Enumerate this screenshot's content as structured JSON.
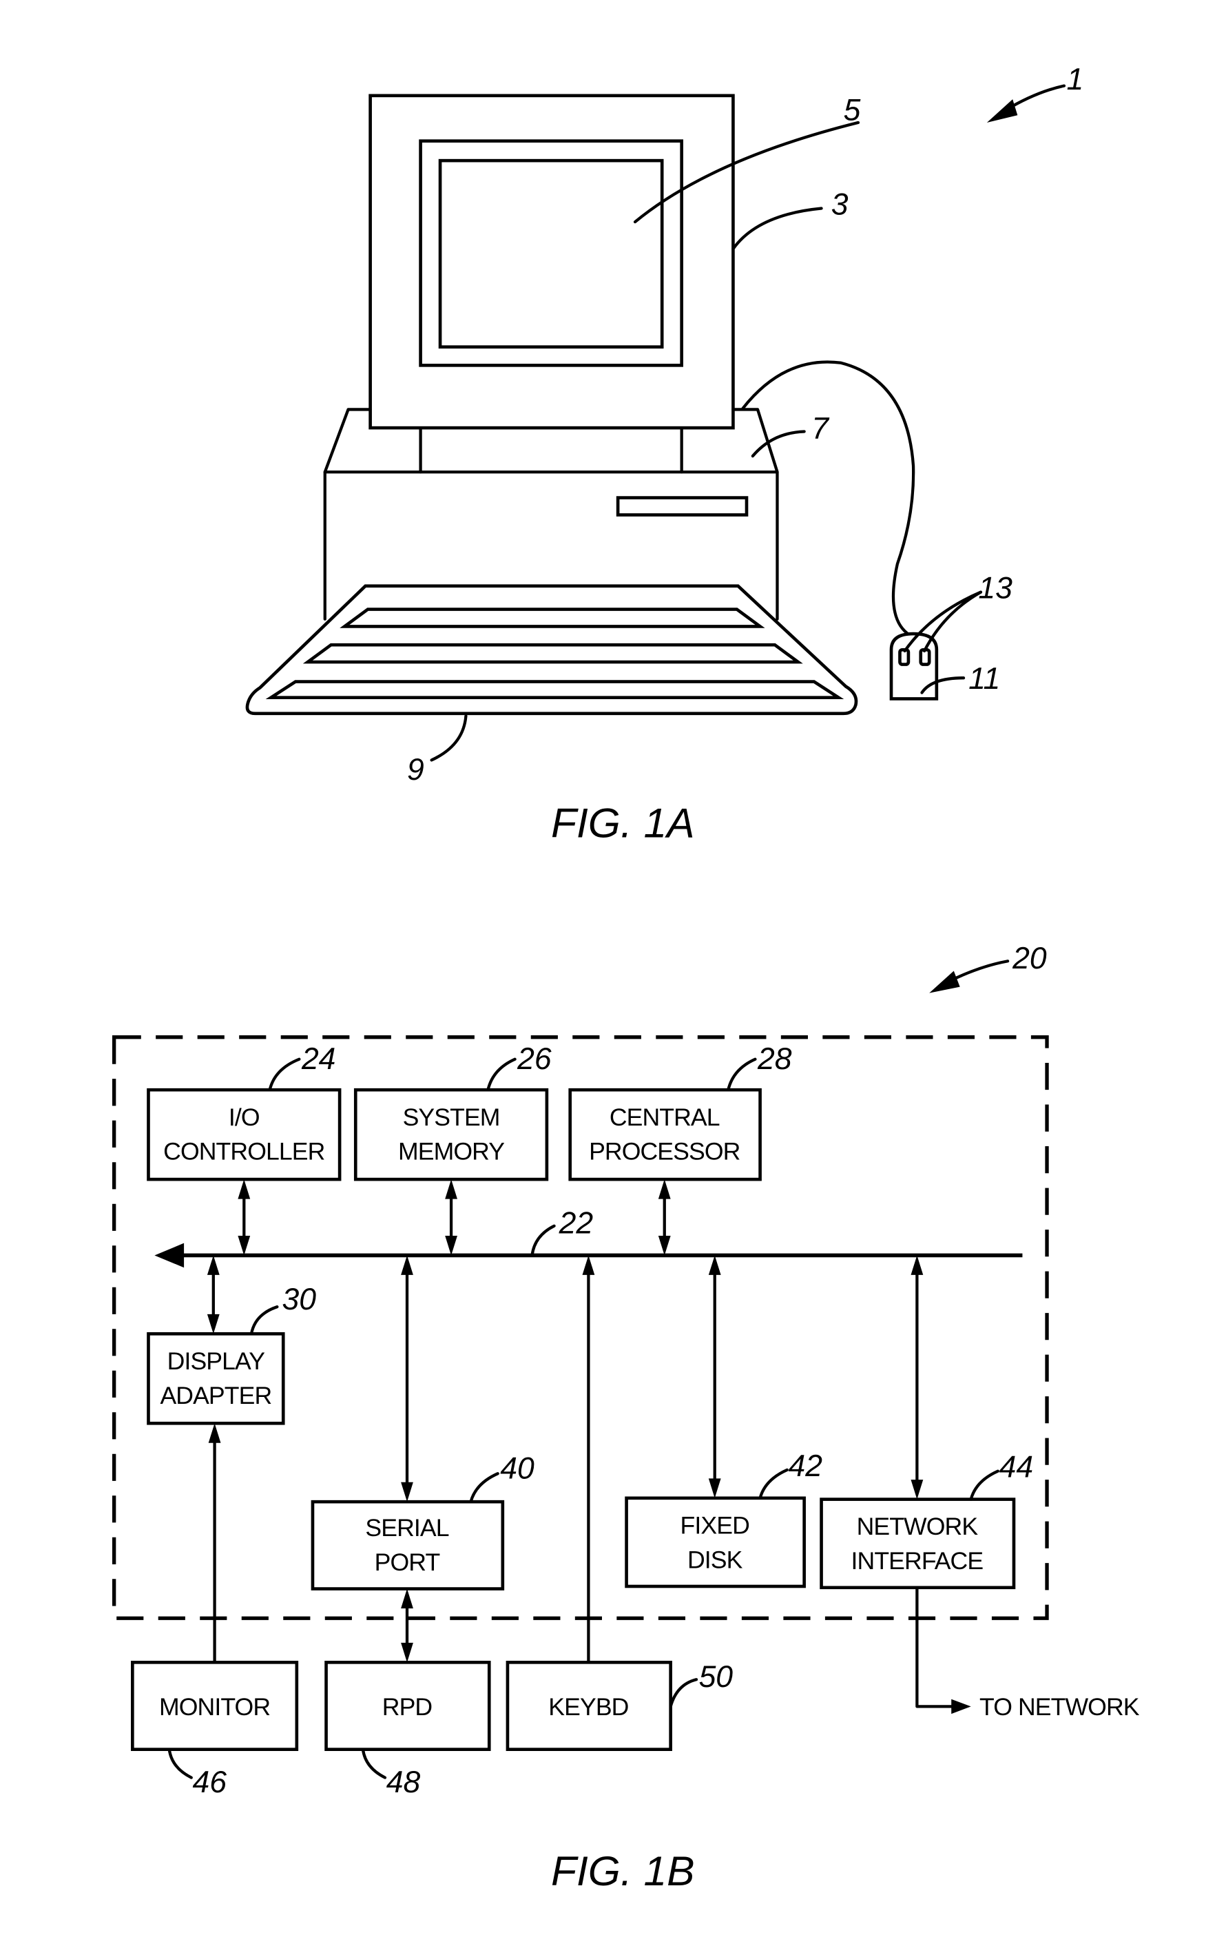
{
  "figures": {
    "fig1a": {
      "caption": "FIG. 1A",
      "refs": {
        "system": "1",
        "monitor_housing": "3",
        "screen": "5",
        "cabinet": "7",
        "keyboard": "9",
        "mouse": "11",
        "mouse_buttons": "13"
      }
    },
    "fig1b": {
      "caption": "FIG. 1B",
      "refs": {
        "system": "20",
        "bus": "22"
      },
      "blocks": {
        "io_controller": {
          "line1": "I/O",
          "line2": "CONTROLLER",
          "ref": "24"
        },
        "system_memory": {
          "line1": "SYSTEM",
          "line2": "MEMORY",
          "ref": "26"
        },
        "central_processor": {
          "line1": "CENTRAL",
          "line2": "PROCESSOR",
          "ref": "28"
        },
        "display_adapter": {
          "line1": "DISPLAY",
          "line2": "ADAPTER",
          "ref": "30"
        },
        "serial_port": {
          "line1": "SERIAL",
          "line2": "PORT",
          "ref": "40"
        },
        "fixed_disk": {
          "line1": "FIXED",
          "line2": "DISK",
          "ref": "42"
        },
        "network_interface": {
          "line1": "NETWORK",
          "line2": "INTERFACE",
          "ref": "44"
        },
        "monitor": {
          "line1": "MONITOR",
          "ref": "46"
        },
        "rpd": {
          "line1": "RPD",
          "ref": "48"
        },
        "keybd": {
          "line1": "KEYBD",
          "ref": "50"
        }
      },
      "to_network_label": "TO NETWORK"
    }
  }
}
